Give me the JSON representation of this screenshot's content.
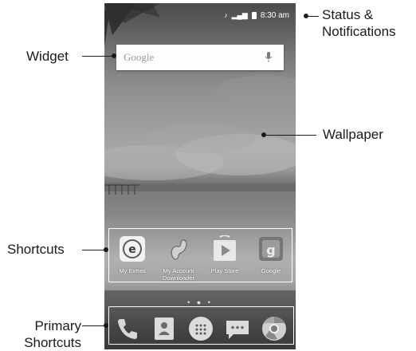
{
  "status_bar": {
    "time": "8:30 am",
    "icons": [
      "notification-icon",
      "signal-icon",
      "battery-icon"
    ]
  },
  "search_widget": {
    "logo_text": "Google",
    "mic_icon": "mic-icon"
  },
  "shortcuts": [
    {
      "label": "My Extras",
      "icon": "my-extras-icon"
    },
    {
      "label": "My Account Downloader",
      "icon": "my-account-downloader-icon"
    },
    {
      "label": "Play Store",
      "icon": "play-store-icon"
    },
    {
      "label": "Google",
      "icon": "google-folder-icon"
    }
  ],
  "page_indicator": {
    "pages": 3,
    "current": 2
  },
  "dock": [
    {
      "icon": "phone-icon"
    },
    {
      "icon": "contacts-icon"
    },
    {
      "icon": "app-drawer-icon"
    },
    {
      "icon": "messaging-icon"
    },
    {
      "icon": "chrome-icon"
    }
  ],
  "callouts": {
    "status": "Status &\nNotifications",
    "widget": "Widget",
    "wallpaper": "Wallpaper",
    "shortcuts": "Shortcuts",
    "primary": "Primary\nShortcuts"
  },
  "colors": {
    "frame": "#ffffff",
    "callout": "#1a1a1a",
    "widget_bg": "#fdfdfd"
  }
}
